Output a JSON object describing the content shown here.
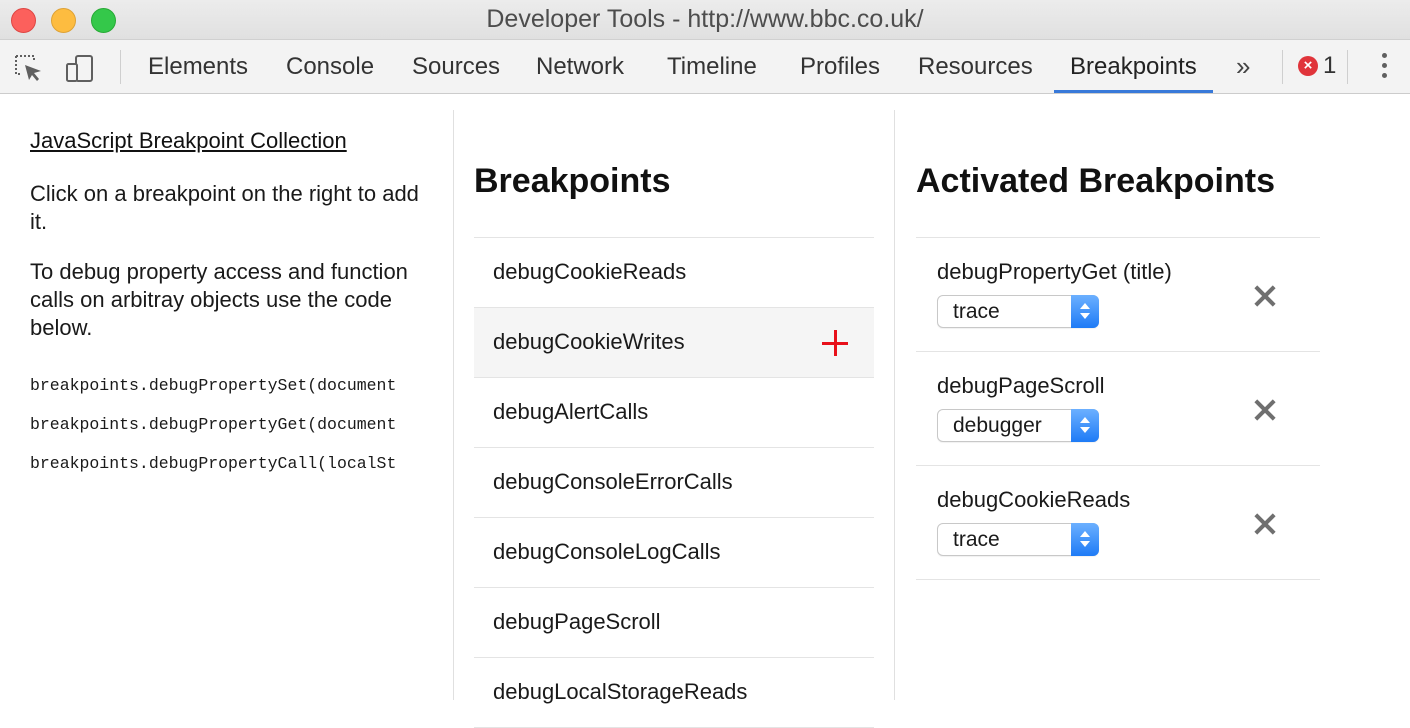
{
  "window": {
    "title": "Developer Tools - http://www.bbc.co.uk/"
  },
  "toolbar": {
    "icons": [
      "inspect-element-icon",
      "device-mode-icon"
    ],
    "tabs": [
      {
        "label": "Elements",
        "active": false
      },
      {
        "label": "Console",
        "active": false
      },
      {
        "label": "Sources",
        "active": false
      },
      {
        "label": "Network",
        "active": false
      },
      {
        "label": "Timeline",
        "active": false
      },
      {
        "label": "Profiles",
        "active": false
      },
      {
        "label": "Resources",
        "active": false
      },
      {
        "label": "Breakpoints",
        "active": true
      }
    ],
    "overflow_symbol": "»",
    "error_count": "1",
    "accent_color": "#3879d9",
    "error_color": "#e0343a"
  },
  "left": {
    "link": "JavaScript Breakpoint Collection",
    "paragraphs": [
      "Click on a breakpoint on the right to add it.",
      "To debug property access and function calls on arbitray objects use the code below."
    ],
    "code": [
      "breakpoints.debugPropertySet(document",
      "breakpoints.debugPropertyGet(document",
      "breakpoints.debugPropertyCall(localSt"
    ]
  },
  "breakpoints": {
    "heading": "Breakpoints",
    "items": [
      "debugCookieReads",
      "debugCookieWrites",
      "debugAlertCalls",
      "debugConsoleErrorCalls",
      "debugConsoleLogCalls",
      "debugPageScroll",
      "debugLocalStorageReads"
    ],
    "hovered": "debugCookieWrites",
    "add_color": "#e8101a"
  },
  "activated": {
    "heading": "Activated Breakpoints",
    "items": [
      {
        "name": "debugPropertyGet (title)",
        "type": "trace"
      },
      {
        "name": "debugPageScroll",
        "type": "debugger"
      },
      {
        "name": "debugCookieReads",
        "type": "trace"
      }
    ]
  }
}
